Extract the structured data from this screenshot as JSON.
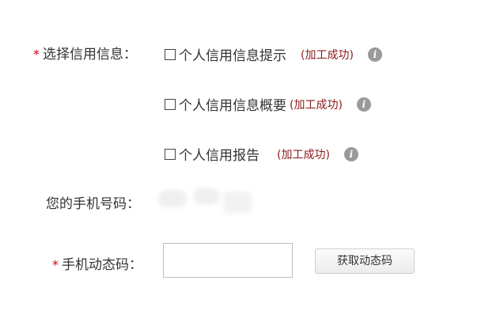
{
  "form": {
    "required_marker": "*",
    "select_label": "选择信用信息：",
    "phone_label": "您的手机号码：",
    "code_label": "手机动态码：",
    "options": [
      {
        "label": "个人信用信息提示",
        "status": "(加工成功)",
        "checked": false
      },
      {
        "label": "个人信用信息概要",
        "status": "(加工成功)",
        "checked": false
      },
      {
        "label": "个人信用报告",
        "status": "(加工成功)",
        "checked": false
      }
    ],
    "info_icon": "info-icon",
    "code_input": {
      "value": "",
      "placeholder": ""
    },
    "send_code_button": "获取动态码"
  }
}
